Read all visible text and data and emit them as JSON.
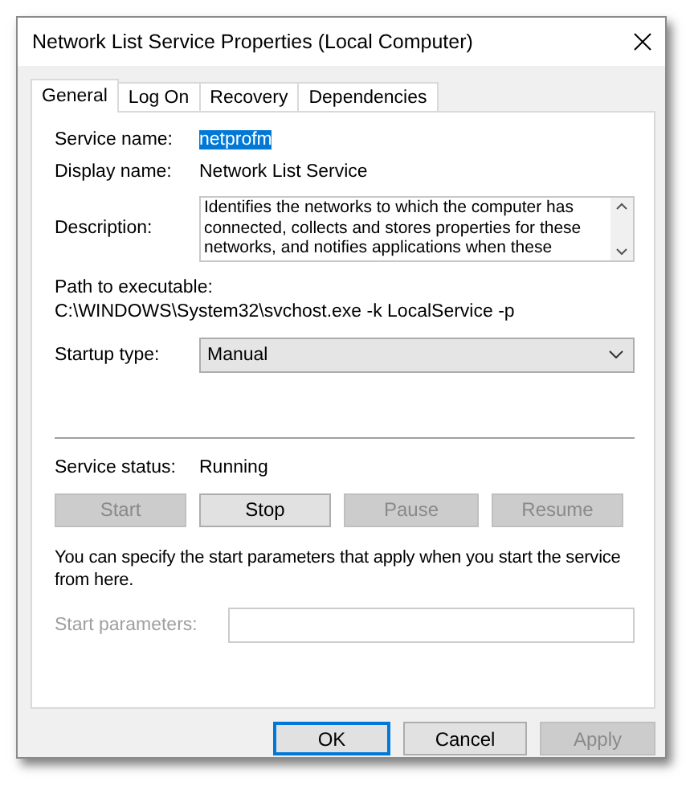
{
  "window": {
    "title": "Network List Service Properties (Local Computer)"
  },
  "tabs": [
    {
      "label": "General",
      "selected": true
    },
    {
      "label": "Log On",
      "selected": false
    },
    {
      "label": "Recovery",
      "selected": false
    },
    {
      "label": "Dependencies",
      "selected": false
    }
  ],
  "service_name": {
    "label": "Service name:",
    "value": "netprofm",
    "highlighted": true
  },
  "display_name": {
    "label": "Display name:",
    "value": "Network List Service"
  },
  "description": {
    "label": "Description:",
    "value": "Identifies the networks to which the computer has connected, collects and stores properties for these networks, and notifies applications when these"
  },
  "path": {
    "label": "Path to executable:",
    "value": "C:\\WINDOWS\\System32\\svchost.exe -k LocalService -p"
  },
  "startup_type": {
    "label": "Startup type:",
    "value": "Manual"
  },
  "service_status": {
    "label": "Service status:",
    "value": "Running"
  },
  "control_buttons": [
    {
      "label": "Start",
      "disabled": true
    },
    {
      "label": "Stop",
      "disabled": false
    },
    {
      "label": "Pause",
      "disabled": true
    },
    {
      "label": "Resume",
      "disabled": true
    }
  ],
  "hint": "You can specify the start parameters that apply when you start the service from here.",
  "start_parameters": {
    "label": "Start parameters:",
    "disabled": true
  },
  "dialog_buttons": [
    {
      "label": "OK",
      "default": true,
      "disabled": false
    },
    {
      "label": "Cancel",
      "default": false,
      "disabled": false
    },
    {
      "label": "Apply",
      "default": false,
      "disabled": true
    }
  ]
}
